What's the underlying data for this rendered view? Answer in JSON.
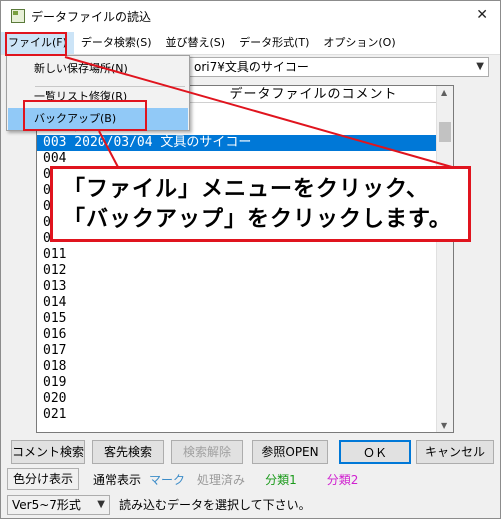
{
  "window": {
    "title": "データファイルの読込",
    "icon_label": "7",
    "close_glyph": "✕"
  },
  "menubar": {
    "items": [
      "ファイル(F)",
      "データ検索(S)",
      "並び替え(S)",
      "データ形式(T)",
      "オプション(O)"
    ]
  },
  "file_menu": {
    "items": [
      "新しい保存場所(N)",
      "一覧リスト修復(R)",
      "バックアップ(B)"
    ],
    "highlighted": "バックアップ(B)"
  },
  "path_combo": {
    "value": "ori7¥文具のサイコー",
    "arrow": "▼"
  },
  "list": {
    "header": "データファイルのコメント",
    "rows": [
      "001                 具のサイコー",
      "002                 具のサイコー",
      "003   2020/03/04 文具のサイコー",
      "004",
      "0",
      "0",
      "0",
      "0",
      "010",
      "011",
      "012",
      "013",
      "014",
      "015",
      "016",
      "017",
      "018",
      "019",
      "020",
      "021"
    ],
    "selected_index": 2
  },
  "callout": {
    "line1": "「ファイル」メニューをクリック、",
    "line2": "「バックアップ」をクリックします。",
    "color": "#e0141e"
  },
  "buttons": {
    "comment_search": "コメント検索",
    "customer_search": "客先検索",
    "search_clear": "検索解除",
    "reference_open": "参照OPEN",
    "ok": "ＯＫ",
    "cancel": "キャンセル"
  },
  "legend": {
    "color_label": "色分け表示",
    "normal": "通常表示",
    "mark": "マーク",
    "processed": "処理済み",
    "category1": "分類1",
    "category2": "分類2",
    "colors": {
      "normal": "#000000",
      "mark": "#3c8cc8",
      "processed": "#9a9a9a",
      "category1": "#1a9a1a",
      "category2": "#d020d0"
    }
  },
  "status": {
    "version": "Ver5~7形式",
    "version_arrow": "▼",
    "message": "読み込むデータを選択して下さい。"
  }
}
